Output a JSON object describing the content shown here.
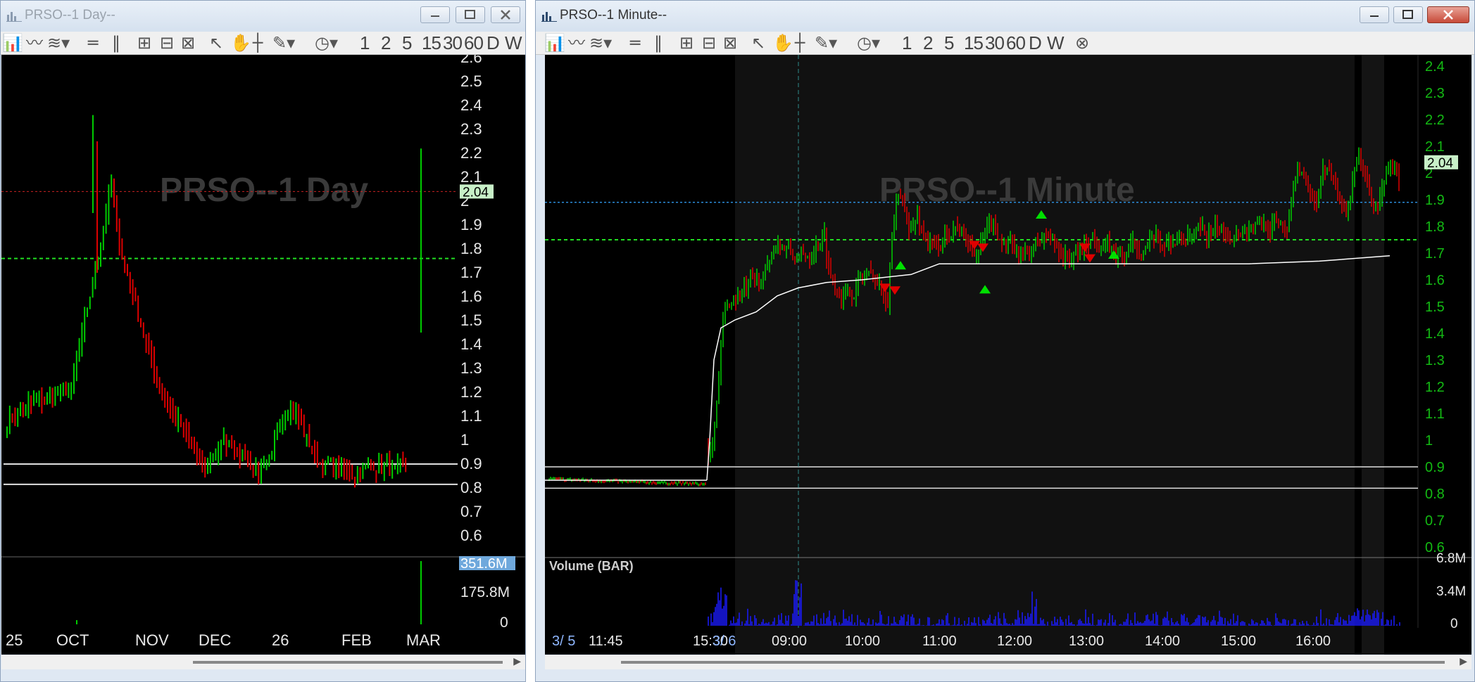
{
  "left_window": {
    "title": "PRSO--1 Day--",
    "watermark": "PRSO--1 Day",
    "last_price": "2.04",
    "y_ticks": [
      "2.6",
      "2.5",
      "2.4",
      "2.3",
      "2.2",
      "2.1",
      "2",
      "1.9",
      "1.8",
      "1.7",
      "1.6",
      "1.5",
      "1.4",
      "1.3",
      "1.2",
      "1.1",
      "1",
      "0.9",
      "0.8",
      "0.7",
      "0.6"
    ],
    "volume_ticks": [
      "351.6M",
      "175.8M",
      "0"
    ],
    "x_labels": [
      "25",
      "OCT",
      "NOV",
      "DEC",
      "26",
      "FEB",
      "MAR"
    ]
  },
  "right_window": {
    "title": "PRSO--1 Minute--",
    "watermark": "PRSO--1 Minute",
    "last_price": "2.04",
    "y_ticks": [
      "2.4",
      "2.3",
      "2.2",
      "2.1",
      "2",
      "1.9",
      "1.8",
      "1.7",
      "1.6",
      "1.5",
      "1.4",
      "1.3",
      "1.2",
      "1.1",
      "1",
      "0.9",
      "0.8",
      "0.7",
      "0.6"
    ],
    "volume_label": "Volume (BAR)",
    "volume_ticks": [
      "6.8M",
      "3.4M",
      "0"
    ],
    "x_labels": [
      "3/ 5",
      "11:45",
      "15:30",
      "3/ 6",
      "09:00",
      "10:00",
      "11:00",
      "12:00",
      "13:00",
      "14:00",
      "15:00",
      "16:00"
    ]
  },
  "toolbar": {
    "intervals": [
      "1",
      "2",
      "5",
      "15",
      "30",
      "60",
      "D",
      "W"
    ]
  },
  "colors": {
    "up": "#00cc00",
    "down": "#dd0000",
    "axis_text": "#e8e8e8",
    "right_axis_text": "#13b913",
    "price_tag_bg": "#c8f0c8",
    "volume": "#1a1aff",
    "dash_green": "#22dd22",
    "dash_blue": "#2b8cd8",
    "dash_red": "#cc2222"
  }
}
